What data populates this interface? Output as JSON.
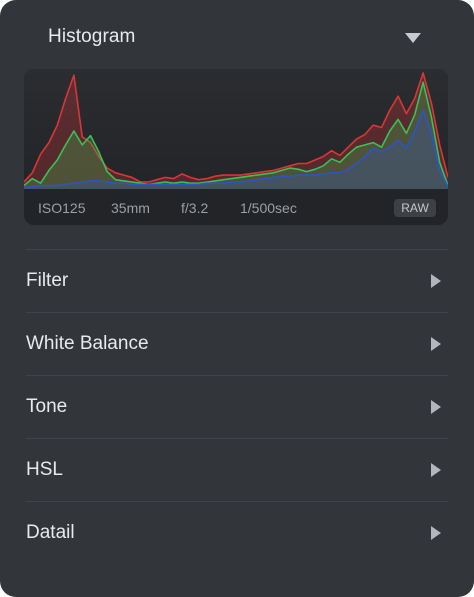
{
  "panel": {
    "title": "Histogram",
    "collapse_icon": "triangle-down-icon"
  },
  "histogram": {
    "exif": {
      "iso": "ISO125",
      "focal_value": "35",
      "focal_unit": "mm",
      "aperture": "f/3.2",
      "shutter": "1/500sec"
    },
    "format_badge": "RAW",
    "channels": [
      {
        "name": "red",
        "color": "#d93636",
        "values": [
          0.06,
          0.14,
          0.3,
          0.4,
          0.55,
          0.78,
          0.98,
          0.45,
          0.4,
          0.28,
          0.18,
          0.14,
          0.12,
          0.1,
          0.06,
          0.06,
          0.08,
          0.1,
          0.09,
          0.13,
          0.1,
          0.08,
          0.09,
          0.11,
          0.12,
          0.12,
          0.12,
          0.13,
          0.14,
          0.15,
          0.16,
          0.18,
          0.2,
          0.22,
          0.22,
          0.25,
          0.28,
          0.33,
          0.29,
          0.36,
          0.43,
          0.47,
          0.55,
          0.53,
          0.68,
          0.8,
          0.65,
          0.78,
          1.0,
          0.74,
          0.38,
          0.1
        ]
      },
      {
        "name": "green",
        "color": "#3dbf55",
        "values": [
          0.03,
          0.09,
          0.05,
          0.16,
          0.25,
          0.38,
          0.5,
          0.38,
          0.46,
          0.32,
          0.15,
          0.08,
          0.07,
          0.06,
          0.05,
          0.04,
          0.05,
          0.06,
          0.05,
          0.06,
          0.05,
          0.05,
          0.06,
          0.07,
          0.08,
          0.09,
          0.1,
          0.11,
          0.12,
          0.13,
          0.14,
          0.16,
          0.18,
          0.17,
          0.15,
          0.17,
          0.2,
          0.26,
          0.23,
          0.3,
          0.36,
          0.38,
          0.4,
          0.36,
          0.5,
          0.6,
          0.48,
          0.64,
          0.92,
          0.62,
          0.23,
          0.03
        ]
      },
      {
        "name": "blue",
        "color": "#2b55c6",
        "values": [
          0.01,
          0.02,
          0.03,
          0.03,
          0.03,
          0.04,
          0.05,
          0.06,
          0.07,
          0.07,
          0.06,
          0.05,
          0.05,
          0.04,
          0.04,
          0.04,
          0.04,
          0.04,
          0.04,
          0.04,
          0.04,
          0.04,
          0.05,
          0.05,
          0.05,
          0.06,
          0.06,
          0.07,
          0.08,
          0.09,
          0.1,
          0.11,
          0.11,
          0.12,
          0.12,
          0.12,
          0.13,
          0.14,
          0.14,
          0.17,
          0.22,
          0.28,
          0.35,
          0.32,
          0.36,
          0.42,
          0.35,
          0.5,
          0.68,
          0.48,
          0.16,
          0.02
        ]
      }
    ]
  },
  "sections": [
    {
      "label": "Filter",
      "arrow_icon": "triangle-right-icon"
    },
    {
      "label": "White Balance",
      "arrow_icon": "triangle-right-icon"
    },
    {
      "label": "Tone",
      "arrow_icon": "triangle-right-icon"
    },
    {
      "label": "HSL",
      "arrow_icon": "triangle-right-icon"
    },
    {
      "label": "Datail",
      "arrow_icon": "triangle-right-icon"
    }
  ]
}
